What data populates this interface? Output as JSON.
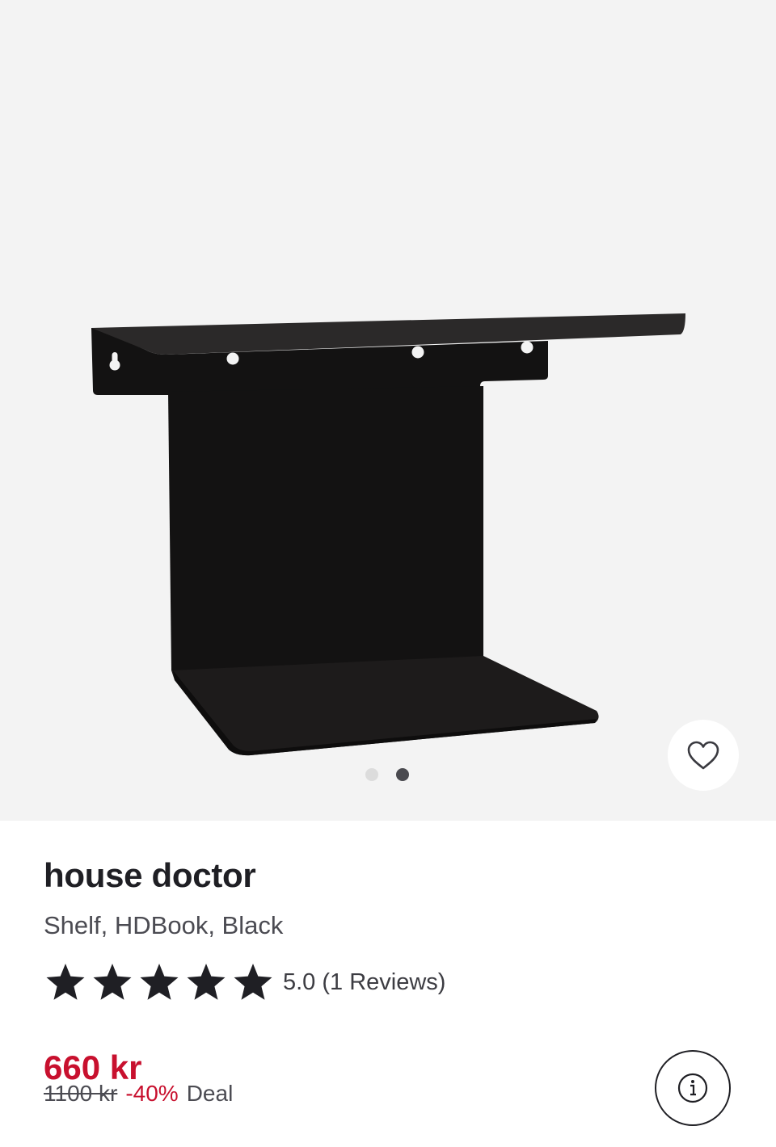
{
  "product": {
    "brand": "house doctor",
    "name": "Shelf, HDBook, Black",
    "rating": 5.0,
    "rating_text": "5.0 (1 Reviews)",
    "stars_filled": 5,
    "price": "660 kr",
    "old_price": "1100 kr",
    "discount": "-40%",
    "deal_label": "Deal"
  },
  "gallery": {
    "image_count": 2,
    "active_index": 1
  },
  "icons": {
    "favorite": "heart-icon",
    "info": "info-icon",
    "star": "star-icon"
  },
  "colors": {
    "price_red": "#c8102e",
    "gallery_bg": "#f3f3f3",
    "text_dark": "#1f1f24",
    "dot_active": "#4a4a4f",
    "dot_inactive": "#dcdcdc"
  }
}
